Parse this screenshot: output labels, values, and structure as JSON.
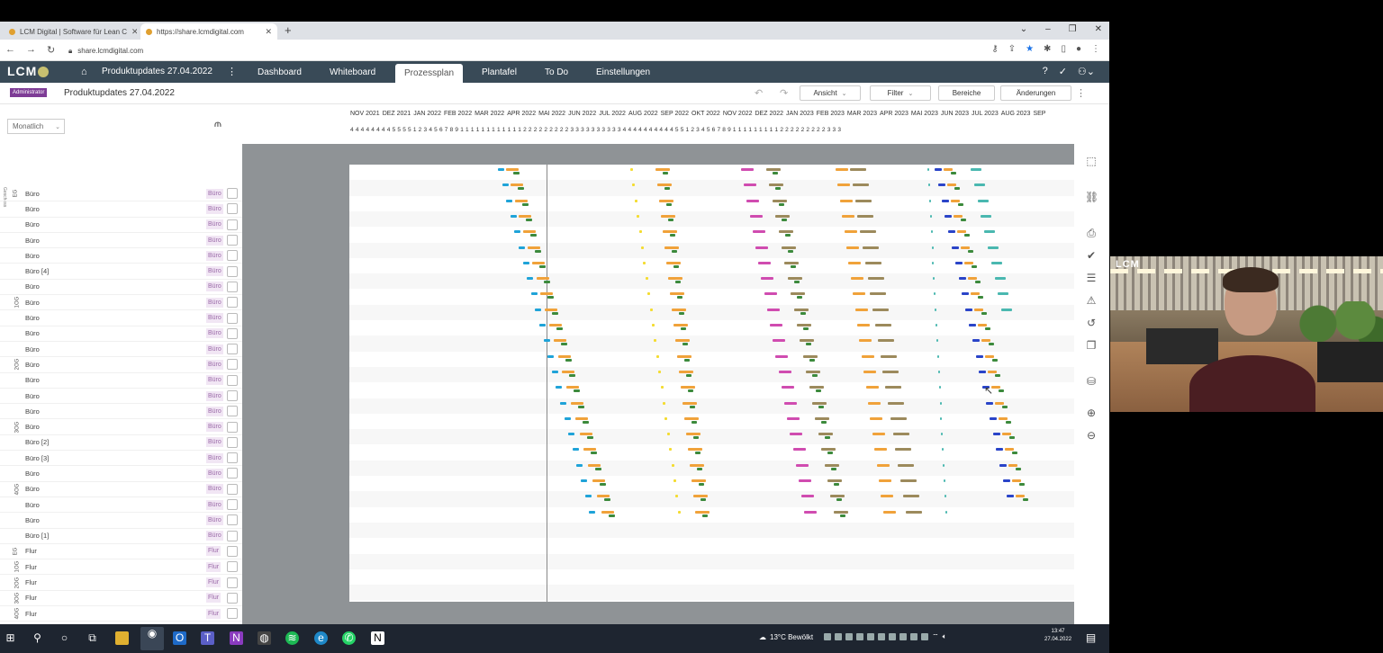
{
  "browser": {
    "tabs": [
      {
        "title": "LCM Digital | Software für Lean C",
        "active": false
      },
      {
        "title": "https://share.lcmdigital.com",
        "active": true
      }
    ],
    "url": "share.lcmdigital.com",
    "new_tab": "+"
  },
  "app": {
    "logo": "LCM",
    "project_title": "Produktupdates 27.04.2022",
    "nav": [
      {
        "label": "Dashboard",
        "active": false
      },
      {
        "label": "Whiteboard",
        "active": false
      },
      {
        "label": "Prozessplan",
        "active": true
      },
      {
        "label": "Plantafel",
        "active": false
      },
      {
        "label": "To Do",
        "active": false
      },
      {
        "label": "Einstellungen",
        "active": false
      }
    ]
  },
  "toolbar": {
    "role_badge": "Administrator",
    "project_title": "Produktupdates 27.04.2022",
    "buttons": [
      {
        "label": "Ansicht",
        "dropdown": true
      },
      {
        "label": "Filter",
        "dropdown": true
      },
      {
        "label": "Bereiche",
        "dropdown": false
      },
      {
        "label": "Änderungen",
        "dropdown": false
      }
    ]
  },
  "left_panel": {
    "view_mode": "Monatlich",
    "side_label": "Geschoss",
    "rows": [
      {
        "name": "Büro",
        "tag": "Büro",
        "level": "EG"
      },
      {
        "name": "Büro",
        "tag": "Büro",
        "level": ""
      },
      {
        "name": "Büro",
        "tag": "Büro",
        "level": ""
      },
      {
        "name": "Büro",
        "tag": "Büro",
        "level": ""
      },
      {
        "name": "Büro",
        "tag": "Büro",
        "level": ""
      },
      {
        "name": "Büro [4]",
        "tag": "Büro",
        "level": ""
      },
      {
        "name": "Büro",
        "tag": "Büro",
        "level": ""
      },
      {
        "name": "Büro",
        "tag": "Büro",
        "level": "1OG"
      },
      {
        "name": "Büro",
        "tag": "Büro",
        "level": ""
      },
      {
        "name": "Büro",
        "tag": "Büro",
        "level": ""
      },
      {
        "name": "Büro",
        "tag": "Büro",
        "level": ""
      },
      {
        "name": "Büro",
        "tag": "Büro",
        "level": "2OG"
      },
      {
        "name": "Büro",
        "tag": "Büro",
        "level": ""
      },
      {
        "name": "Büro",
        "tag": "Büro",
        "level": ""
      },
      {
        "name": "Büro",
        "tag": "Büro",
        "level": ""
      },
      {
        "name": "Büro",
        "tag": "Büro",
        "level": "3OG"
      },
      {
        "name": "Büro [2]",
        "tag": "Büro",
        "level": ""
      },
      {
        "name": "Büro [3]",
        "tag": "Büro",
        "level": ""
      },
      {
        "name": "Büro",
        "tag": "Büro",
        "level": ""
      },
      {
        "name": "Büro",
        "tag": "Büro",
        "level": "4OG"
      },
      {
        "name": "Büro",
        "tag": "Büro",
        "level": ""
      },
      {
        "name": "Büro",
        "tag": "Büro",
        "level": ""
      },
      {
        "name": "Büro [1]",
        "tag": "Büro",
        "level": ""
      },
      {
        "name": "Flur",
        "tag": "Flur",
        "level": "EG"
      },
      {
        "name": "Flur",
        "tag": "Flur",
        "level": "1OG"
      },
      {
        "name": "Flur",
        "tag": "Flur",
        "level": "2OG"
      },
      {
        "name": "Flur",
        "tag": "Flur",
        "level": "3OG"
      },
      {
        "name": "Flur",
        "tag": "Flur",
        "level": "4OG"
      }
    ]
  },
  "timeline": {
    "months": [
      "NOV 2021",
      "DEZ 2021",
      "JAN 2022",
      "FEB 2022",
      "MAR 2022",
      "APR 2022",
      "MAI 2022",
      "JUN 2022",
      "JUL 2022",
      "AUG 2022",
      "SEP 2022",
      "OKT 2022",
      "NOV 2022",
      "DEZ 2022",
      "JAN 2023",
      "FEB 2023",
      "MAR 2023",
      "APR 2023",
      "MAI 2023",
      "JUN 2023",
      "JUL 2023",
      "AUG 2023",
      "SEP"
    ],
    "weeks": "4 4 4 4 4 4 4 4 5 5 5 5 1 2 3 4 5 6 7 8 9 1 1 1 1 1 1 1 1 1 1 1 1 2 2 2 2 2 2 2 2 2 3 3 3 3 3 3 3 3 3 3 4 4 4 4 4 4 4 4 4 4 5 5 1 2 3 4 5 6 7 8 9 1 1 1 1 1 1 1 1 1 2 2 2 2 2 2 2 2 2 3 3 3"
  },
  "webcam": {
    "logo": "LCM"
  },
  "taskbar": {
    "weather": "13°C  Bewölkt",
    "time": "13:47",
    "date": "27.04.2022"
  },
  "colors": {
    "header_bg": "#394a57",
    "badge": "#7e3c96",
    "cyan": "#1fa3d8",
    "orange": "#f0a23a",
    "green": "#3c8a3c",
    "yellow": "#f4dc30",
    "magenta": "#d04cb0",
    "olive": "#9c8a5c",
    "blue": "#2a44c8",
    "teal": "#4ab8b0"
  }
}
